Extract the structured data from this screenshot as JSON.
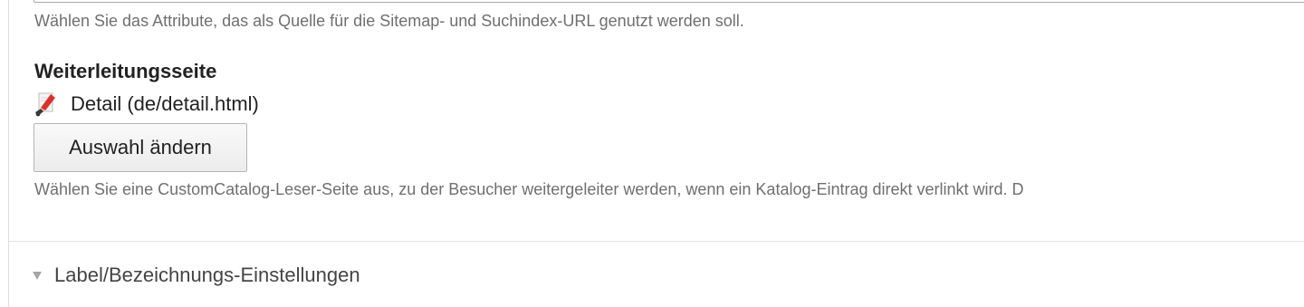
{
  "url_source": {
    "help": "Wählen Sie das Attribute, das als Quelle für die Sitemap- und Suchindex-URL genutzt werden soll."
  },
  "redirect": {
    "label": "Weiterleitungsseite",
    "selected_page": "Detail (de/detail.html)",
    "page_icon": "page-edit-icon",
    "change_button": "Auswahl ändern",
    "help": "Wählen Sie eine CustomCatalog-Leser-Seite aus, zu der Besucher weitergeleiter werden, wenn ein Katalog-Eintrag direkt verlinkt wird. D"
  },
  "label_section": {
    "title": "Label/Bezeichnungs-Einstellungen",
    "state": "collapsed"
  }
}
